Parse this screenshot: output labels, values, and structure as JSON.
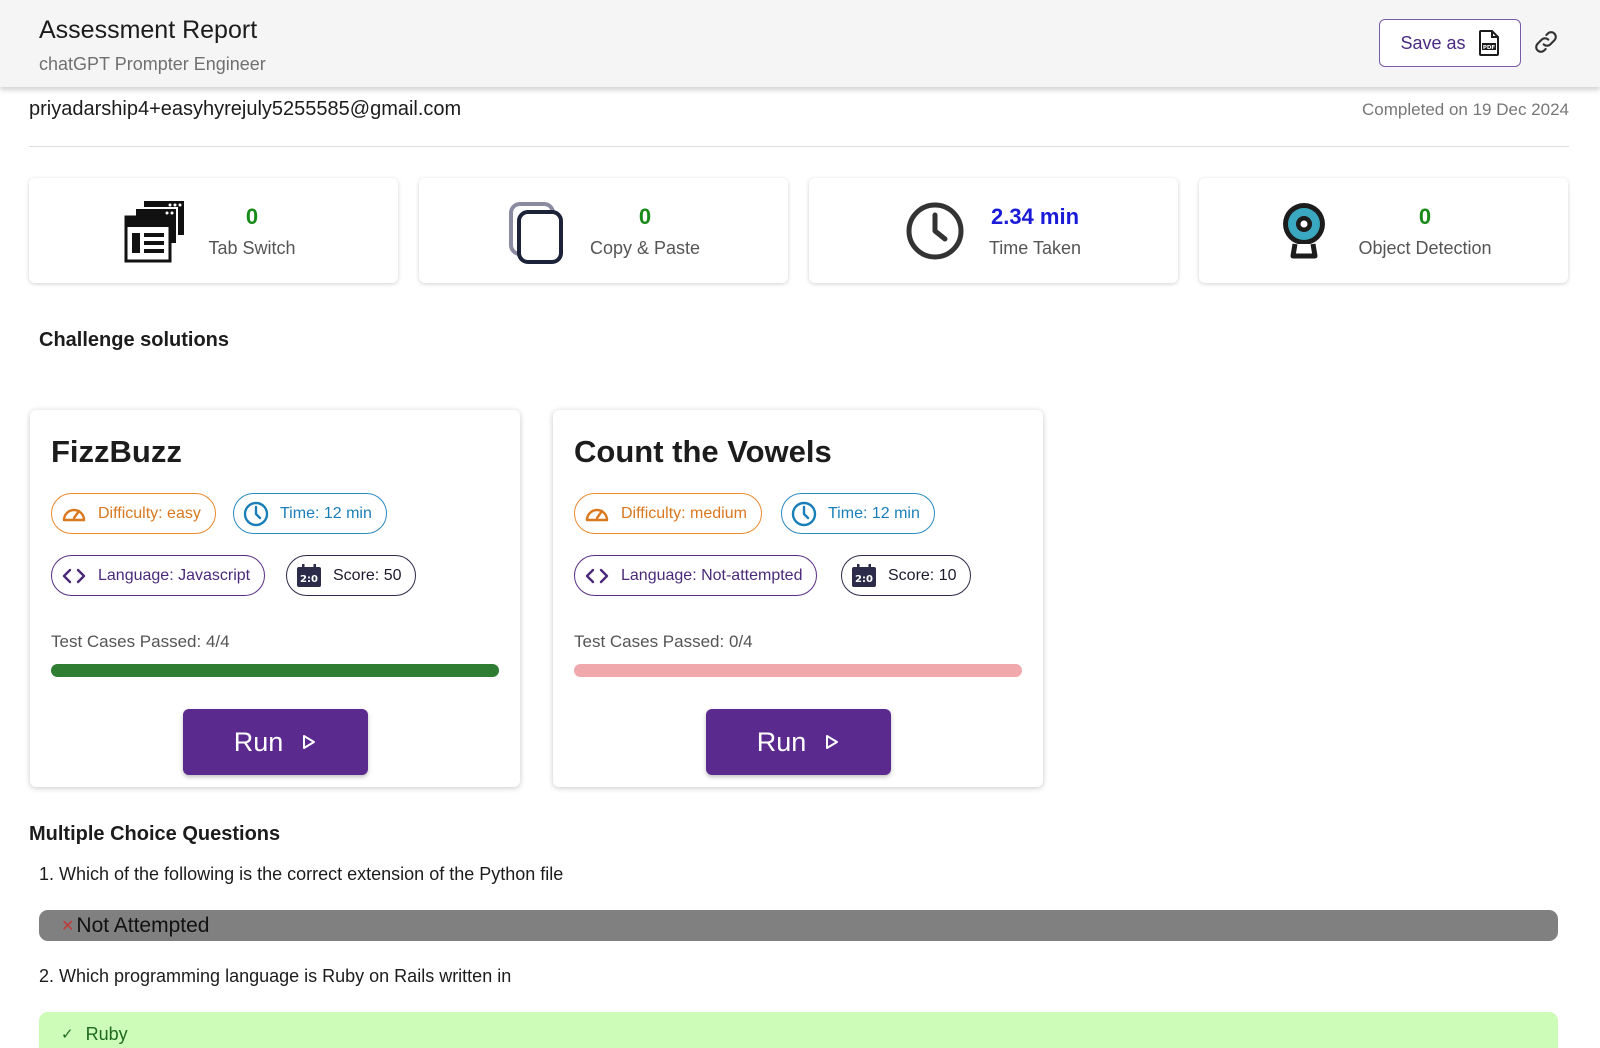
{
  "header": {
    "title": "Assessment Report",
    "subtitle": "chatGPT Prompter Engineer",
    "save_label": "Save as",
    "save_icon": "pdf-file-icon",
    "link_icon": "link-icon"
  },
  "candidate": {
    "email": "priyadarship4+easyhyrejuly5255585@gmail.com",
    "completed": "Completed on 19 Dec 2024"
  },
  "stats": [
    {
      "value": "0",
      "label": "Tab Switch",
      "icon": "tab-switch-icon",
      "color": "#1a8a1a"
    },
    {
      "value": "0",
      "label": "Copy & Paste",
      "icon": "copy-paste-icon",
      "color": "#1a8a1a"
    },
    {
      "value": "2.34 min",
      "label": "Time Taken",
      "icon": "clock-icon",
      "color": "#1a1ad8"
    },
    {
      "value": "0",
      "label": "Object Detection",
      "icon": "webcam-icon",
      "color": "#1a8a1a"
    }
  ],
  "challenges_title": "Challenge solutions",
  "challenges": [
    {
      "title": "FizzBuzz",
      "difficulty": "Difficulty: easy",
      "time": "Time: 12 min",
      "language": "Language: Javascript",
      "score": "Score: 50",
      "test_cases": "Test Cases Passed: 4/4",
      "progress": 1.0,
      "bar_color": "#2e7d32",
      "run_label": "Run"
    },
    {
      "title": "Count the Vowels",
      "difficulty": "Difficulty: medium",
      "time": "Time: 12 min",
      "language": "Language: Not-attempted",
      "score": "Score: 10",
      "test_cases": "Test Cases Passed: 0/4",
      "progress": 0.0,
      "bar_color": "#f0a8ac",
      "run_label": "Run"
    }
  ],
  "mcq_title": "Multiple Choice Questions",
  "mcq": [
    {
      "question": "1. Which of the following is the correct extension of the Python file",
      "answer": "Not Attempted",
      "status": "not-attempted"
    },
    {
      "question": "2. Which programming language is Ruby on Rails written in",
      "answer": "Ruby",
      "status": "correct"
    }
  ]
}
